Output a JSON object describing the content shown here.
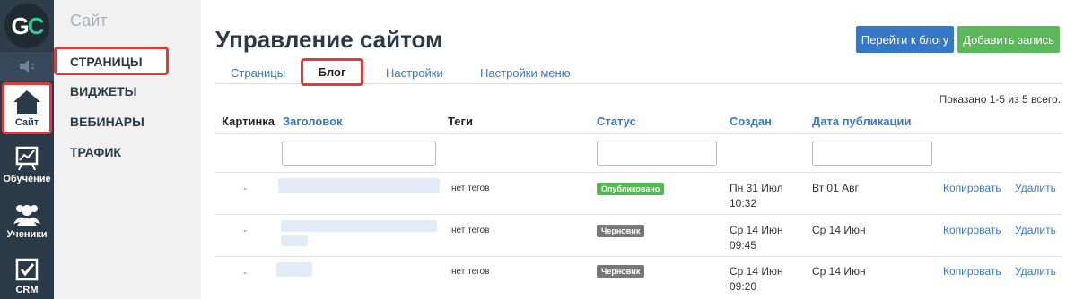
{
  "rail": {
    "logo_g": "G",
    "logo_c": "C",
    "site_label": "Сайт",
    "learn_label": "Обучение",
    "users_label": "Ученики",
    "crm_label": "CRM"
  },
  "submenu": {
    "title": "Сайт",
    "items": [
      "СТРАНИЦЫ",
      "ВИДЖЕТЫ",
      "ВЕБИНАРЫ",
      "ТРАФИК"
    ]
  },
  "header": {
    "title": "Управление сайтом",
    "go_to_blog": "Перейти к блогу",
    "add_post": "Добавить запись"
  },
  "tabs": [
    "Страницы",
    "Блог",
    "Настройки",
    "Настройки меню"
  ],
  "summary": "Показано 1-5 из 5 всего.",
  "table": {
    "columns": [
      "Картинка",
      "Заголовок",
      "Теги",
      "Статус",
      "Создан",
      "Дата публикации"
    ],
    "rows": [
      {
        "picture": "-",
        "tags": "нет тегов",
        "status": "Опубликовано",
        "status_color": "#56b556",
        "created_1": "Пн 31 Июл",
        "created_2": "10:32",
        "published": "Вт 01 Авг",
        "copy": "Копировать",
        "delete": "Удалить"
      },
      {
        "picture": "-",
        "tags": "нет тегов",
        "status": "Черновик",
        "status_color": "#777777",
        "created_1": "Ср 14 Июн",
        "created_2": "09:45",
        "published": "Ср 14 Июн",
        "copy": "Копировать",
        "delete": "Удалить"
      },
      {
        "picture": "-",
        "tags": "нет тегов",
        "status": "Черновик",
        "status_color": "#777777",
        "created_1": "Ср 14 Июн",
        "created_2": "09:20",
        "published": "Ср 14 Июн",
        "copy": "Копировать",
        "delete": "Удалить"
      }
    ]
  },
  "colors": {
    "rail": "#2b3a47",
    "link": "#3578c8",
    "primary_button": "#3578c8",
    "success_button": "#5bb85b",
    "highlight": "#e03a3a"
  },
  "icons": [
    "speaker-icon",
    "home-icon",
    "chart-board-icon",
    "users-icon",
    "checkbox-icon"
  ]
}
